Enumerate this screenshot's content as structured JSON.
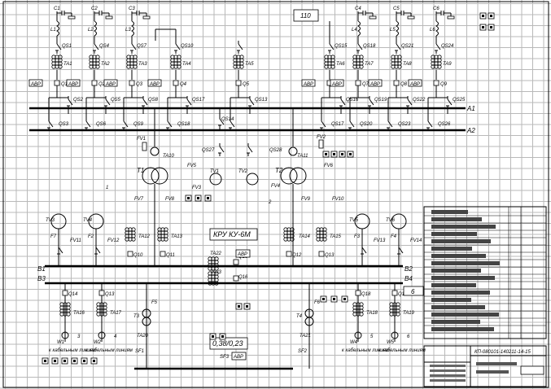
{
  "diagram": {
    "buses": {
      "a1": "A1",
      "a2": "A2",
      "b1": "B1",
      "b2": "B2",
      "b3": "B3",
      "b4": "B4"
    },
    "top_box": "110",
    "kru_label": "КРУ КУ-6М",
    "lv_label": "0,38/0,23",
    "avr_label": "АВР",
    "stamp_code": "КП-080101-140211-14-15",
    "top_feeders": [
      {
        "c": "C1",
        "l": "L1",
        "qs": "QS1",
        "ta": "TA1",
        "q": "Q1",
        "qs_a": "QS2",
        "qs_b": "QS3"
      },
      {
        "c": "C2",
        "l": "L2",
        "qs": "QS4",
        "ta": "TA2",
        "q": "Q2",
        "qs_a": "QS5",
        "qs_b": "QS6"
      },
      {
        "c": "C3",
        "l": "L3",
        "qs": "QS7",
        "ta": "TA3",
        "q": "Q3",
        "qs_a": "QS8",
        "qs_b": "QS9"
      },
      {
        "c": "",
        "l": "",
        "qs": "QS10",
        "ta": "TA4",
        "q": "Q4",
        "qs_a": "QS17",
        "qs_b": "QS18"
      },
      {
        "c": "",
        "l": "",
        "qs": "",
        "ta": "TA5",
        "q": "Q5",
        "qs_a": "QS13",
        "qs_b": ""
      },
      {
        "c": "",
        "l": "",
        "qs": "QS15",
        "ta": "TA6",
        "q": "Q6",
        "qs_a": "QS16",
        "qs_b": "QS17"
      },
      {
        "c": "C4",
        "l": "L4",
        "qs": "QS18",
        "ta": "TA7",
        "q": "Q7",
        "qs_a": "QS19",
        "qs_b": "QS20"
      },
      {
        "c": "C5",
        "l": "L5",
        "qs": "QS21",
        "ta": "TA8",
        "q": "Q8",
        "qs_a": "QS22",
        "qs_b": "QS23"
      },
      {
        "c": "C6",
        "l": "L6",
        "qs": "QS24",
        "ta": "TA9",
        "q": "Q9",
        "qs_a": "QS25",
        "qs_b": "QS26"
      }
    ],
    "mid_labels": {
      "qs14": "QS14",
      "qs27": "QS27",
      "qs28": "QS28",
      "fv1": "FV1",
      "fv2": "FV2",
      "fv3": "FV3",
      "fv4": "FV4",
      "fv5": "FV5",
      "fv6": "FV6",
      "ta10": "TA10",
      "ta11": "TA11",
      "t1": "T1",
      "t2": "T2",
      "tv1": "TV1",
      "tv2": "TV2",
      "fv7": "FV7",
      "fv8": "FV8",
      "fv9": "FV9",
      "fv10": "FV10",
      "ta12": "TA12",
      "ta13": "TA13",
      "ta14": "TA14",
      "ta15": "TA15",
      "q10": "Q10",
      "q11": "Q11",
      "q12": "Q12",
      "q13": "Q13",
      "ta22": "TA22",
      "q15": "Q15",
      "q16": "Q16",
      "ta23": "TA23",
      "n1": "1",
      "n2": "2"
    },
    "side_groups": [
      {
        "tv": "TV3",
        "f": "F7",
        "fv": "FV11"
      },
      {
        "tv": "TV4",
        "f": "F2",
        "fv": "FV12"
      },
      {
        "tv": "TV5",
        "f": "F3",
        "fv": "FV13"
      },
      {
        "tv": "TV6",
        "f": "F4",
        "fv": "FV14"
      }
    ],
    "bottom": {
      "q14": "Q14",
      "q13b": "Q13",
      "ta16": "TA16",
      "ta17": "TA17",
      "w1": "W1",
      "w2": "W2",
      "t3": "T3",
      "t4": "T4",
      "f5": "F5",
      "f6": "F6",
      "ta20": "TA20",
      "ta21": "TA21",
      "sf1": "SF1",
      "sf2": "SF2",
      "sf3": "SF3",
      "q18": "Q18",
      "q17": "Q17",
      "ta18": "TA18",
      "ta19": "TA19",
      "w4": "W4",
      "w5": "W5",
      "n3": "3",
      "n4": "4",
      "n5": "5",
      "n6": "6",
      "n6box": "6",
      "cable1": "к кабельным линиям",
      "cable2": "к кабельным линиям",
      "cable3": "к кабельным линиям",
      "cable4": "к кабельным линиям"
    }
  }
}
